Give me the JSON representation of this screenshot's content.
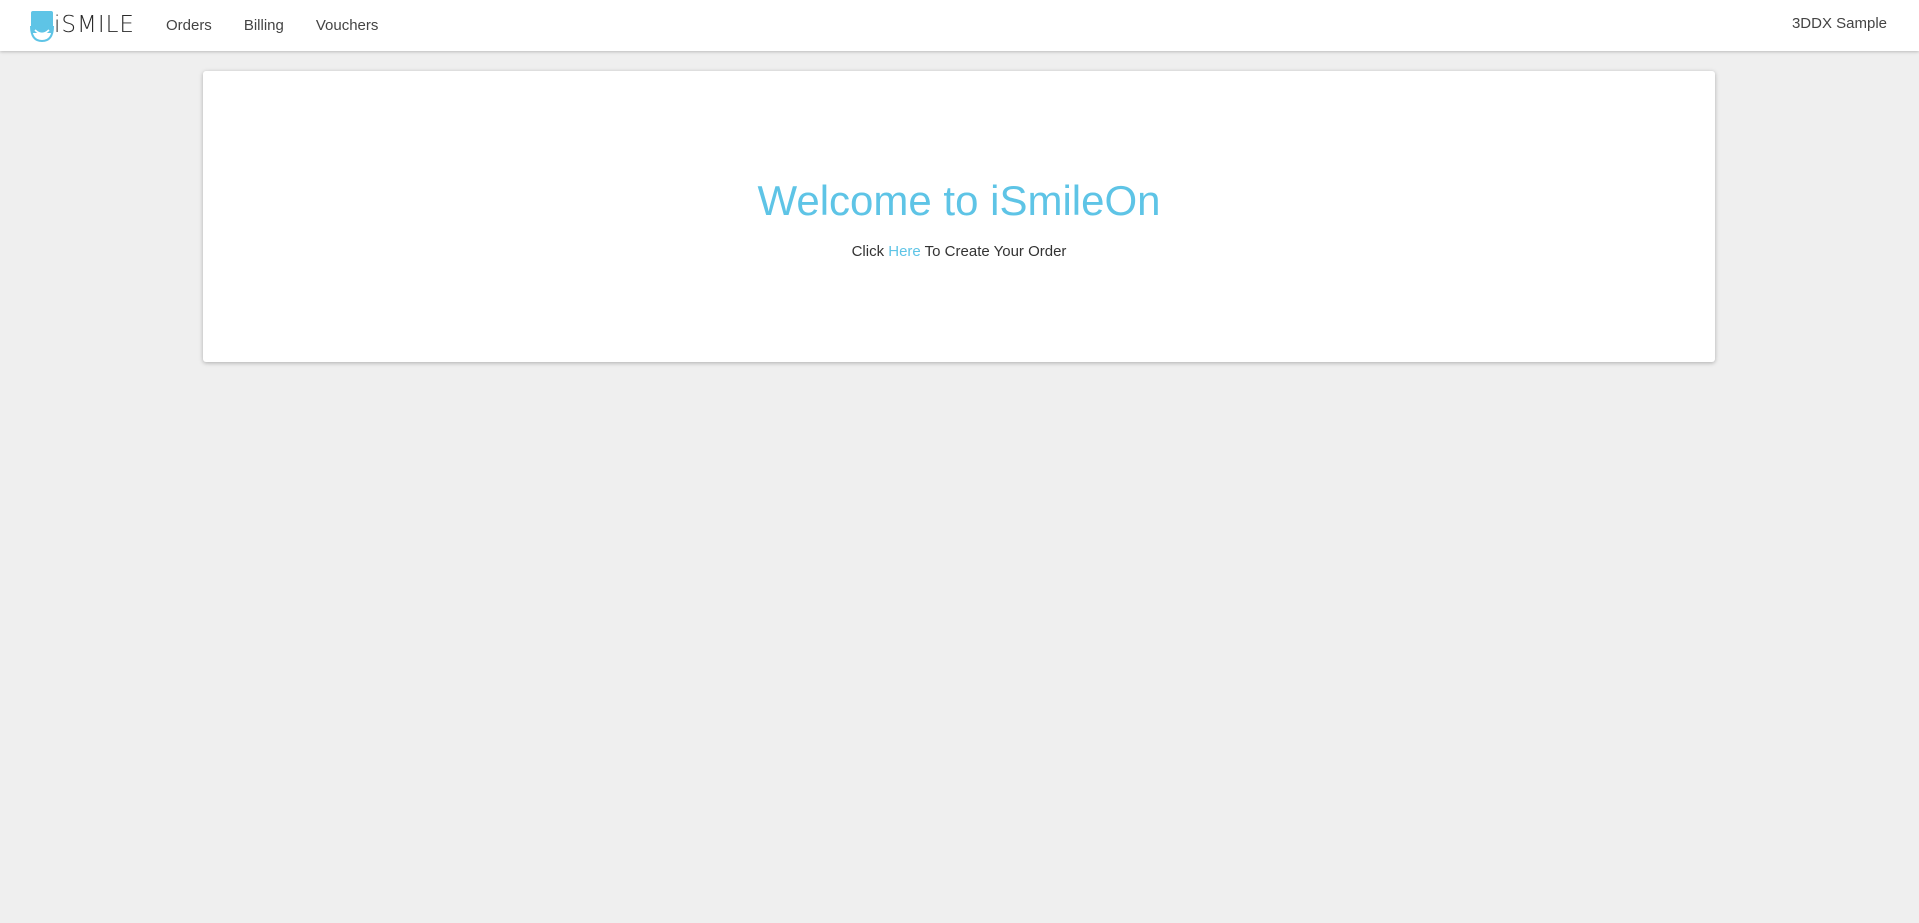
{
  "brand": {
    "name": "iSMILE",
    "accent_color": "#5ec4e6",
    "logo_icon": "tooth-smile-icon"
  },
  "nav": {
    "items": [
      {
        "label": "Orders"
      },
      {
        "label": "Billing"
      },
      {
        "label": "Vouchers"
      }
    ],
    "user_name": "3DDX Sample"
  },
  "main": {
    "title": "Welcome to iSmileOn",
    "subtitle_prefix": "Click",
    "subtitle_link": "Here",
    "subtitle_suffix": "To Create Your Order"
  },
  "colors": {
    "background": "#efefef",
    "card": "#ffffff",
    "accent": "#5ec4e6"
  }
}
